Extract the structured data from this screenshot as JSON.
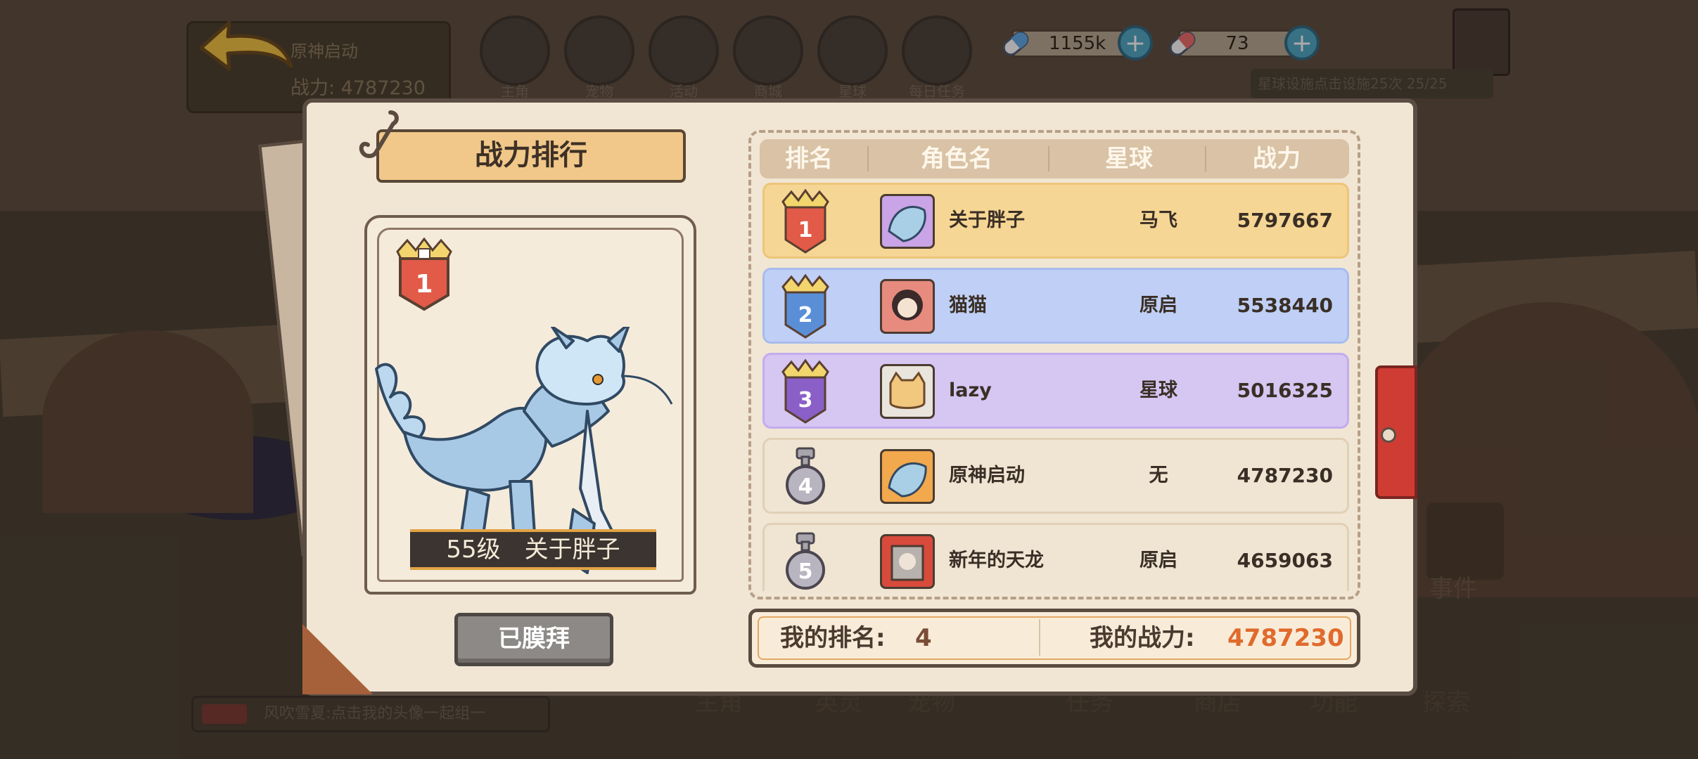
{
  "background": {
    "rank_chip_title": "原神启动",
    "rank_chip_score_label": "战力: 4787230",
    "top_icons": [
      "主角",
      "宠物",
      "活动",
      "商城",
      "星球",
      "每日任务"
    ],
    "notice": "星球设施点击设施25次 25/25",
    "bottom_nav": [
      "主角",
      "英灵",
      "宠物",
      "任务",
      "商店",
      "功能",
      "探索"
    ],
    "chat": "风吹雪夏:点击我的头像一起组一",
    "event_label": "事件"
  },
  "currency": {
    "blue_amount": "1155k",
    "red_amount": "73",
    "plus_symbol": "+"
  },
  "panel": {
    "title": "战力排行",
    "featured": {
      "rank": "1",
      "level_name": "55级　关于胖子"
    },
    "worship_button": "已膜拜",
    "columns": {
      "rank": "排名",
      "name": "角色名",
      "planet": "星球",
      "power": "战力"
    },
    "rows": [
      {
        "rank": "1",
        "name": "关于胖子",
        "planet": "马飞",
        "power": "5797667"
      },
      {
        "rank": "2",
        "name": "猫猫",
        "planet": "原启",
        "power": "5538440"
      },
      {
        "rank": "3",
        "name": "lazy",
        "planet": "星球",
        "power": "5016325"
      },
      {
        "rank": "4",
        "name": "原神启动",
        "planet": "无",
        "power": "4787230"
      },
      {
        "rank": "5",
        "name": "新年的天龙",
        "planet": "原启",
        "power": "4659063"
      }
    ],
    "my_rank_label": "我的排名:",
    "my_rank_value": "4",
    "my_power_label": "我的战力:",
    "my_power_value": "4787230"
  },
  "colors": {
    "gold_row": "#f6d694",
    "silver_row": "#bfcff5",
    "bronze_row": "#d6c6f2",
    "normal_row": "#f0e5d2",
    "power_highlight": "#e06a2c"
  }
}
